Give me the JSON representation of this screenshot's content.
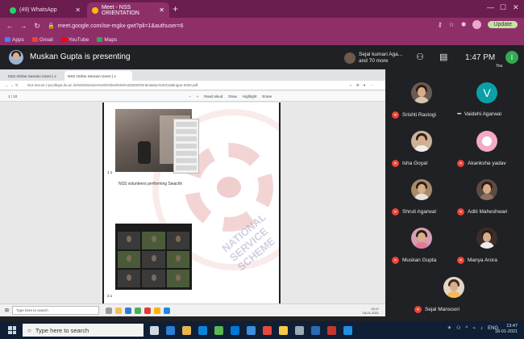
{
  "browser": {
    "tabs": [
      {
        "title": "(49) WhatsApp",
        "favicon_color": "#25d366"
      },
      {
        "title": "Meet - NSS ORIENTATION",
        "favicon_color": "#fbbc04"
      }
    ],
    "url": "meet.google.com/ise-mgkx-gwt?pli=1&authuser=6",
    "bookmarks": [
      "Apps",
      "Gmail",
      "YouTube",
      "Maps"
    ],
    "update_label": "Update",
    "accent_color": "#8e2f6a"
  },
  "meet": {
    "presenting_text": "Muskan Gupta is presenting",
    "pinned": {
      "line1": "Sejal kumari Aga...",
      "line2": "and 70 more"
    },
    "time": "1:47 PM",
    "you_initial": "I",
    "you_label": "You"
  },
  "shared_screen": {
    "tabs": [
      "NSS Online Session Users | x",
      "NSS Online Session Users | x"
    ],
    "address": "Not secure | ipcollege.du.ac.in/NSS/Session%20Online/NSS%202020/Orientation%20Catalogue-2020.pdf",
    "page_indicator": "1 / 10",
    "toolbar": [
      "Read aloud",
      "Draw",
      "Highlight",
      "Erase"
    ],
    "photo1_label": "1.1",
    "caption": "NSS volunteers performing Swachh",
    "photo2_label": "2.1",
    "watermark": "NATIONAL SERVICE SCHEME",
    "inner_search": "Type here to search",
    "inner_tray": {
      "time": "13:47",
      "date": "18-01-2021"
    }
  },
  "participants": [
    {
      "name": "Srishti Rastogi",
      "status": "muted",
      "avatar": "photo"
    },
    {
      "name": "Vaidehi Agarwal",
      "status": "dots",
      "avatar": "initial",
      "initial": "V"
    },
    {
      "name": "Isha Goyal",
      "status": "muted",
      "avatar": "photo"
    },
    {
      "name": "Akanksha yadav",
      "status": "muted",
      "avatar": "photo"
    },
    {
      "name": "Shruti Agarwal",
      "status": "muted",
      "avatar": "photo"
    },
    {
      "name": "Aditi Maheshwari",
      "status": "muted",
      "avatar": "photo"
    },
    {
      "name": "Muskan Gupta",
      "status": "muted",
      "avatar": "photo"
    },
    {
      "name": "Manya Arora",
      "status": "muted",
      "avatar": "photo"
    },
    {
      "name": "Sejal Mansoori",
      "status": "muted",
      "avatar": "photo"
    }
  ],
  "taskbar": {
    "search_placeholder": "Type here to search",
    "tray_lang": "ENG",
    "time": "13:47",
    "date": "18-01-2021"
  }
}
